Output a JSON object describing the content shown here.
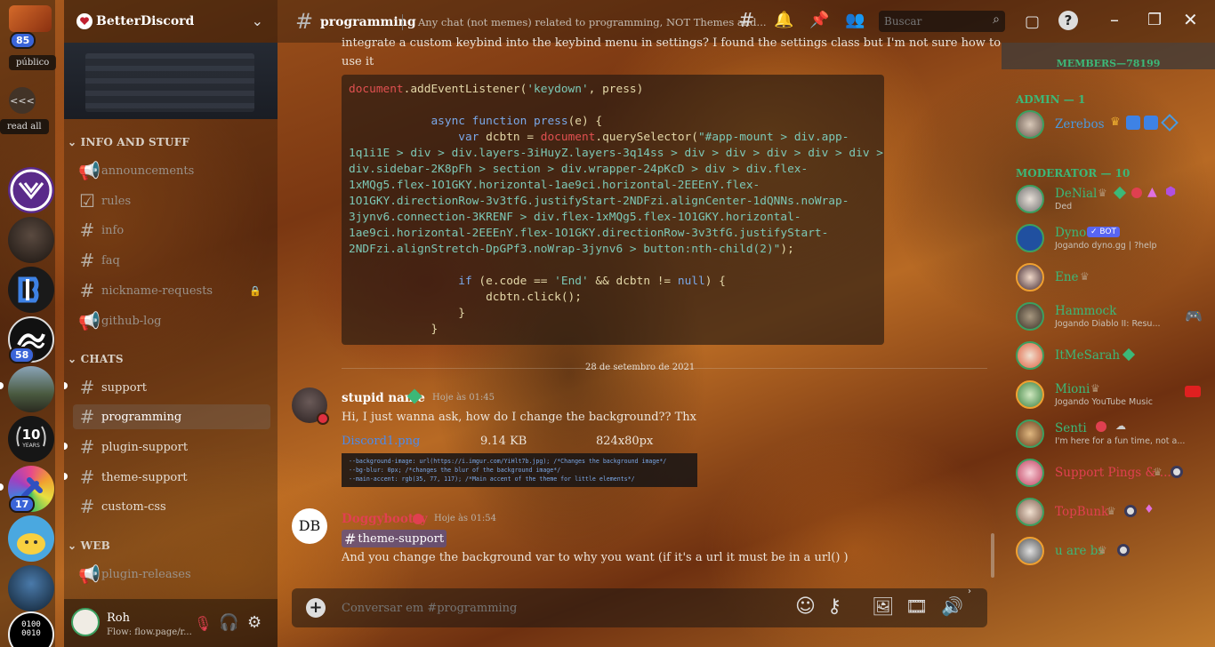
{
  "rail": {
    "top_badge": "85",
    "tooltip_public": "público",
    "collapse": "<<<",
    "read_all": "read all",
    "badge_58": "58",
    "badge_17": "17",
    "ten_years": "10",
    "ten_years_sub": "YEARS"
  },
  "guild": {
    "name": "BetterDiscord"
  },
  "categories": {
    "info": "INFO AND STUFF",
    "chats": "CHATS",
    "web": "WEB"
  },
  "channels_info": [
    {
      "name": "announcements"
    },
    {
      "name": "rules"
    },
    {
      "name": "info"
    },
    {
      "name": "faq"
    },
    {
      "name": "nickname-requests"
    },
    {
      "name": "github-log"
    }
  ],
  "channels_chats": [
    {
      "name": "support"
    },
    {
      "name": "programming"
    },
    {
      "name": "plugin-support"
    },
    {
      "name": "theme-support"
    },
    {
      "name": "custom-css"
    }
  ],
  "channels_web": [
    {
      "name": "plugin-releases"
    }
  ],
  "user": {
    "name": "Roh",
    "status": "Flow: flow.page/r..."
  },
  "header": {
    "channel": "programming",
    "topic": "Any chat (not memes) related to programming, NOT Themes and...",
    "search_placeholder": "Buscar"
  },
  "messages": {
    "prev_line1": "integrate a custom keybind into the keybind menu in settings? I found the settings class but I'm not sure how to",
    "prev_line2": "use it",
    "date_divider": "28 de setembro de 2021",
    "m1_author": "stupid name",
    "m1_time": "Hoje às 01:45",
    "m1_text": "Hi, I just wanna ask, how do I change the background?? Thx",
    "attachment_name": "Discord1.png",
    "attachment_size": "9.14 KB",
    "attachment_dims": "824x80px",
    "css_line1": "--background-image: url(https://i.imgur.com/YiHlt7b.jpg); /*Changes the background image*/",
    "css_line2": "--bg-blur: 0px; /*changes the blur of the background image*/",
    "css_line3": "--main-accent: rgb(35, 77, 117); /*Main accent of the theme for little elements*/",
    "m2_author": "Doggybootsy",
    "m2_avatar": "DB",
    "m2_time": "Hoje às 01:54",
    "m2_mention": "theme-support",
    "m2_text": "And you change the background var to why you want (if it's a url it must be in a url() )"
  },
  "code": {
    "l1a": "document",
    "l1b": ".addEventListener(",
    "l1c": "'keydown'",
    "l1d": ", press)",
    "l3a": "async function ",
    "l3b": "press",
    "l3c": "(e) {",
    "l4a": "var ",
    "l4b": "dcbtn = ",
    "l4c": "document",
    "l4d": ".querySelector(",
    "sel1": "\"#app-mount > div.app-",
    "sel2": "1q1i1E > div > div.layers-3iHuyZ.layers-3q14ss > div > div > div > div > div >",
    "sel3": "div.sidebar-2K8pFh > section > div.wrapper-24pKcD > div > div.flex-",
    "sel4": "1xMQg5.flex-1O1GKY.horizontal-1ae9ci.horizontal-2EEEnY.flex-",
    "sel5": "1O1GKY.directionRow-3v3tfG.justifyStart-2NDFzi.alignCenter-1dQNNs.noWrap-",
    "sel6": "3jynv6.connection-3KRENF > div.flex-1xMQg5.flex-1O1GKY.horizontal-",
    "sel7": "1ae9ci.horizontal-2EEEnY.flex-1O1GKY.directionRow-3v3tfG.justifyStart-",
    "sel8": "2NDFzi.alignStretch-DpGPf3.noWrap-3jynv6 > button:nth-child(2)\"",
    "sel8end": ");",
    "l6a": "if ",
    "l6b": "(e.code == ",
    "l6c": "'End'",
    "l6d": " && dcbtn != ",
    "l6e": "null",
    "l6f": ") {",
    "l7": "dcbtn.click();",
    "l8": "}",
    "l9": "}"
  },
  "composer": {
    "placeholder": "Conversar em #programming"
  },
  "members": {
    "header": "MEMBERS—78199",
    "admin_cat": "ADMIN — 1",
    "mod_cat": "MODERATOR — 10",
    "list": [
      {
        "name": "Zerebos",
        "sub": ""
      },
      {
        "name": "DeNial",
        "sub": "Ded"
      },
      {
        "name": "Dyno",
        "sub": "Jogando dyno.gg | ?help",
        "bot": "BOT"
      },
      {
        "name": "Ene",
        "sub": ""
      },
      {
        "name": "Hammock",
        "sub": "Jogando Diablo II: Resu..."
      },
      {
        "name": "ItMeSarah",
        "sub": ""
      },
      {
        "name": "Mioni",
        "sub": "Jogando YouTube Music"
      },
      {
        "name": "Senti",
        "sub": "I'm here for a fun time, not a..."
      },
      {
        "name": "Support Pings & ...",
        "sub": ""
      },
      {
        "name": "TopBunk",
        "sub": ""
      },
      {
        "name": "u are bs",
        "sub": ""
      }
    ]
  },
  "colors": {
    "accent_green": "#3cb878",
    "mention_red": "#e04050",
    "link_blue": "#4a8cf0"
  }
}
